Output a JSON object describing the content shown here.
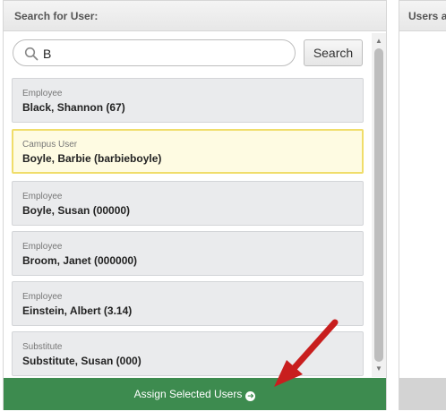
{
  "left_panel": {
    "title": "Search for User:",
    "search": {
      "value": "B",
      "button_label": "Search"
    },
    "results": [
      {
        "role": "Employee",
        "name": "Black, Shannon (67)",
        "selected": false
      },
      {
        "role": "Campus User",
        "name": "Boyle, Barbie (barbieboyle)",
        "selected": true
      },
      {
        "role": "Employee",
        "name": "Boyle, Susan (00000)",
        "selected": false
      },
      {
        "role": "Employee",
        "name": "Broom, Janet (000000)",
        "selected": false
      },
      {
        "role": "Employee",
        "name": "Einstein, Albert (3.14)",
        "selected": false
      },
      {
        "role": "Substitute",
        "name": "Substitute, Susan (000)",
        "selected": false
      }
    ],
    "assign_label": "Assign Selected Users"
  },
  "right_panel": {
    "title": "Users a"
  },
  "colors": {
    "assign_bar": "#3d8b4f",
    "selected_border": "#f0dd6a",
    "selected_bg": "#fefbe2",
    "annotation_arrow": "#c81e1e"
  }
}
